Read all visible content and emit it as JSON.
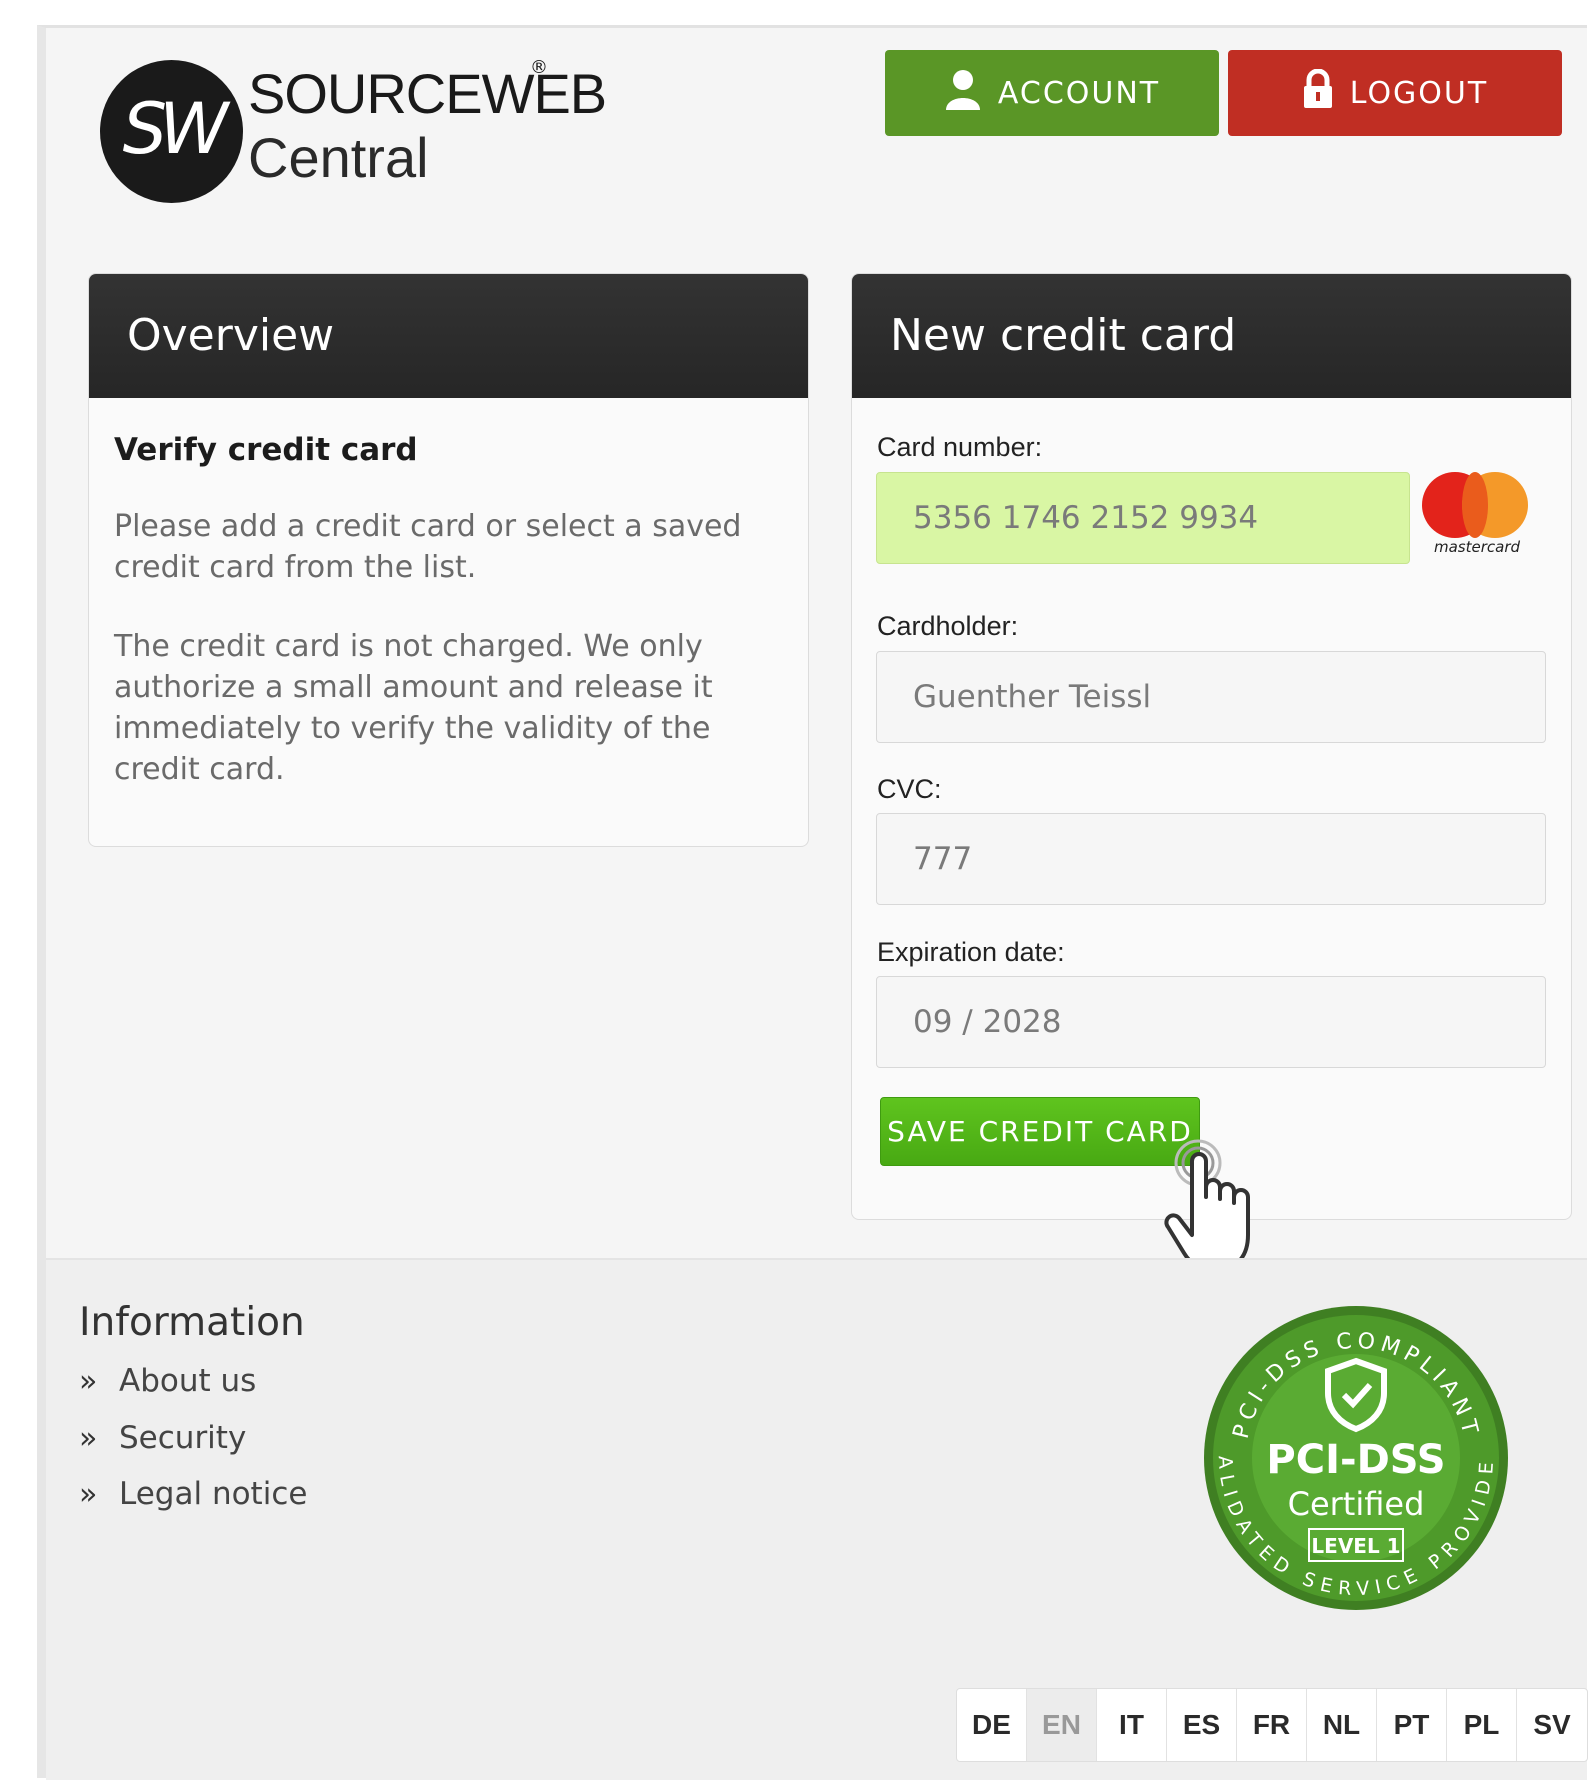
{
  "header": {
    "logo": {
      "mark": "SW",
      "brand": "SOURCEWEB",
      "reg": "®",
      "sub": "Central"
    },
    "account_label": "ACCOUNT",
    "logout_label": "LOGOUT"
  },
  "overview": {
    "heading": "Overview",
    "title": "Verify credit card",
    "paragraph1": "Please add a credit card or select a saved credit card from the list.",
    "paragraph2": "The credit card is not charged. We only authorize a small amount and release it immediately to verify the validity of the credit card."
  },
  "new_card": {
    "heading": "New credit card",
    "card_number_label": "Card number:",
    "card_number_value": "5356 1746 2152 9934",
    "card_brand": "mastercard",
    "cardholder_label": "Cardholder:",
    "cardholder_value": "Guenther Teissl",
    "cvc_label": "CVC:",
    "cvc_value": "777",
    "expiration_label": "Expiration date:",
    "expiration_value": "09 / 2028",
    "save_label": "SAVE CREDIT CARD"
  },
  "footer": {
    "info_title": "Information",
    "links": [
      "About us",
      "Security",
      "Legal notice"
    ],
    "badge": {
      "top_arc": "PCI-DSS COMPLIANT",
      "bottom_arc": "VALIDATED SERVICE PROVIDER",
      "title": "PCI-DSS",
      "subtitle": "Certified",
      "level": "LEVEL 1"
    },
    "languages": [
      "DE",
      "EN",
      "IT",
      "ES",
      "FR",
      "NL",
      "PT",
      "PL",
      "SV"
    ],
    "active_language": "EN"
  },
  "colors": {
    "account": "#5a9626",
    "logout": "#c02e23",
    "panel_header": "#2b2b2b",
    "valid_input": "#d9f6a4",
    "save_button": "#52b518",
    "badge_green": "#4e9a2a"
  }
}
